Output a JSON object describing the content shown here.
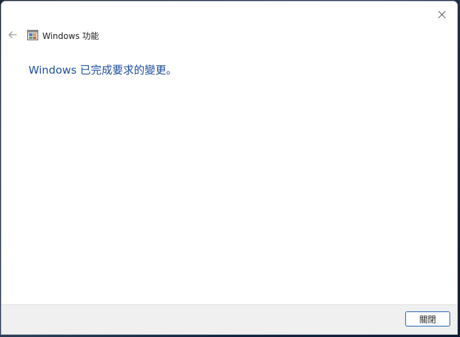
{
  "window": {
    "title": "Windows 功能",
    "close_icon": "close-icon",
    "back_icon": "back-arrow-icon",
    "app_icon": "windows-features-icon"
  },
  "main": {
    "message": "Windows 已完成要求的變更。"
  },
  "footer": {
    "close_label": "關閉"
  },
  "colors": {
    "message": "#1e4e9a",
    "footer_bg": "#f0f0f0",
    "button_border": "#3b6fb6"
  }
}
